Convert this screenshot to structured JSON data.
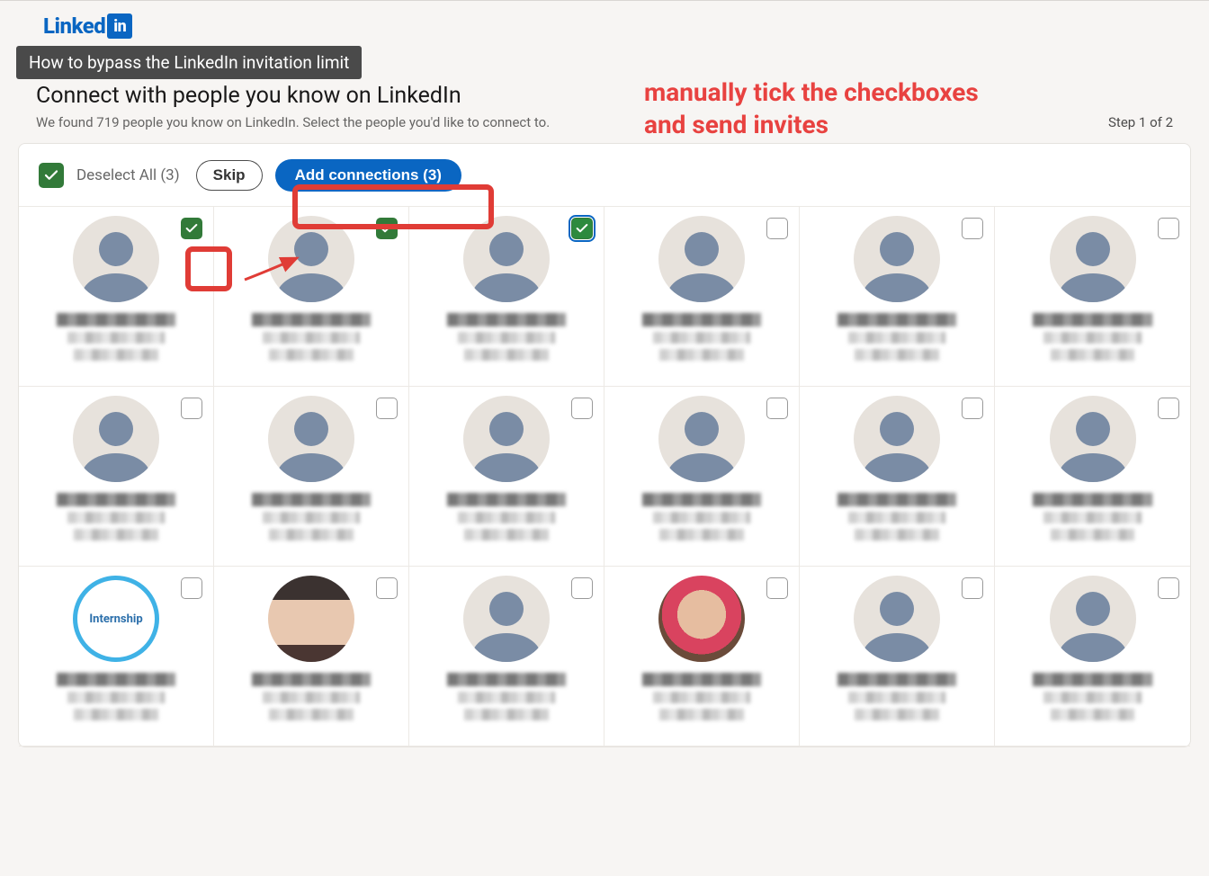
{
  "logo": {
    "text": "Linked",
    "badge": "in"
  },
  "tooltip": "How to bypass the LinkedIn invitation limit",
  "header": {
    "title": "Connect with people you know on LinkedIn",
    "subtitle": "We found 719 people you know on LinkedIn. Select the people you'd like to connect to.",
    "step": "Step 1 of 2"
  },
  "annotation": "manually tick the checkboxes\nand send invites",
  "toolbar": {
    "deselect": "Deselect All (3)",
    "skip": "Skip",
    "add": "Add connections (3)"
  },
  "internship_label": "Internship",
  "colors": {
    "linkedin_blue": "#0a66c2",
    "check_green": "#327a39",
    "annotation_red": "#e84240"
  },
  "cells": [
    {
      "checked": true,
      "avatar": "default"
    },
    {
      "checked": true,
      "avatar": "default"
    },
    {
      "checked": true,
      "avatar": "default",
      "alt": true
    },
    {
      "checked": false,
      "avatar": "default"
    },
    {
      "checked": false,
      "avatar": "default"
    },
    {
      "checked": false,
      "avatar": "default"
    },
    {
      "checked": false,
      "avatar": "default"
    },
    {
      "checked": false,
      "avatar": "default"
    },
    {
      "checked": false,
      "avatar": "default"
    },
    {
      "checked": false,
      "avatar": "default"
    },
    {
      "checked": false,
      "avatar": "default"
    },
    {
      "checked": false,
      "avatar": "default"
    },
    {
      "checked": false,
      "avatar": "internship"
    },
    {
      "checked": false,
      "avatar": "face1"
    },
    {
      "checked": false,
      "avatar": "default"
    },
    {
      "checked": false,
      "avatar": "face2"
    },
    {
      "checked": false,
      "avatar": "default"
    },
    {
      "checked": false,
      "avatar": "default"
    }
  ]
}
